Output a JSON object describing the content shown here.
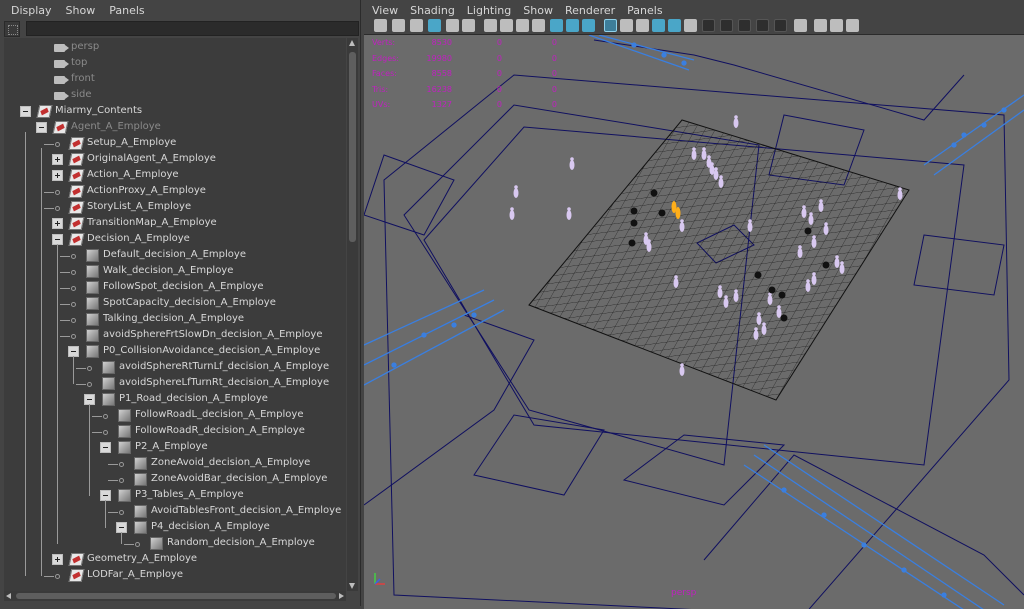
{
  "outliner": {
    "menu": [
      "Display",
      "Show",
      "Panels"
    ],
    "search_placeholder": "",
    "items": [
      {
        "label": "persp",
        "icon": "camera-icon",
        "depth": 1,
        "dim": true
      },
      {
        "label": "top",
        "icon": "camera-icon",
        "depth": 1,
        "dim": true
      },
      {
        "label": "front",
        "icon": "camera-icon",
        "depth": 1,
        "dim": true
      },
      {
        "label": "side",
        "icon": "camera-icon",
        "depth": 1,
        "dim": true
      },
      {
        "label": "Miarmy_Contents",
        "icon": "miarmy-folder-icon",
        "depth": 0,
        "expander": "minus"
      },
      {
        "label": "Agent_A_Employe",
        "icon": "miarmy-folder-icon",
        "depth": 1,
        "expander": "minus",
        "dim": true
      },
      {
        "label": "Setup_A_Employe",
        "icon": "miarmy-folder-icon",
        "depth": 2
      },
      {
        "label": "OriginalAgent_A_Employe",
        "icon": "miarmy-folder-icon",
        "depth": 2,
        "expander": "plus"
      },
      {
        "label": "Action_A_Employe",
        "icon": "miarmy-folder-icon",
        "depth": 2,
        "expander": "plus"
      },
      {
        "label": "ActionProxy_A_Employe",
        "icon": "miarmy-folder-icon",
        "depth": 2
      },
      {
        "label": "StoryList_A_Employe",
        "icon": "miarmy-folder-icon",
        "depth": 2
      },
      {
        "label": "TransitionMap_A_Employe",
        "icon": "miarmy-folder-icon",
        "depth": 2,
        "expander": "plus"
      },
      {
        "label": "Decision_A_Employe",
        "icon": "miarmy-folder-icon",
        "depth": 2,
        "expander": "minus"
      },
      {
        "label": "Default_decision_A_Employe",
        "icon": "decision-node-icon",
        "depth": 3
      },
      {
        "label": "Walk_decision_A_Employe",
        "icon": "decision-node-icon",
        "depth": 3
      },
      {
        "label": "FollowSpot_decision_A_Employe",
        "icon": "decision-node-icon",
        "depth": 3
      },
      {
        "label": "SpotCapacity_decision_A_Employe",
        "icon": "decision-node-icon",
        "depth": 3
      },
      {
        "label": "Talking_decision_A_Employe",
        "icon": "decision-node-icon",
        "depth": 3
      },
      {
        "label": "avoidSphereFrtSlowDn_decision_A_Employe",
        "icon": "decision-node-icon",
        "depth": 3
      },
      {
        "label": "P0_CollisionAvoidance_decision_A_Employe",
        "icon": "decision-node-icon",
        "depth": 3,
        "expander": "minus"
      },
      {
        "label": "avoidSphereRtTurnLf_decision_A_Employe",
        "icon": "decision-node-icon",
        "depth": 4
      },
      {
        "label": "avoidSphereLfTurnRt_decision_A_Employe",
        "icon": "decision-node-icon",
        "depth": 4
      },
      {
        "label": "P1_Road_decision_A_Employe",
        "icon": "decision-node-icon",
        "depth": 4,
        "expander": "minus"
      },
      {
        "label": "FollowRoadL_decision_A_Employe",
        "icon": "decision-node-icon",
        "depth": 5
      },
      {
        "label": "FollowRoadR_decision_A_Employe",
        "icon": "decision-node-icon",
        "depth": 5
      },
      {
        "label": "P2_A_Employe",
        "icon": "decision-node-icon",
        "depth": 5,
        "expander": "minus"
      },
      {
        "label": "ZoneAvoid_decision_A_Employe",
        "icon": "decision-node-icon",
        "depth": 6
      },
      {
        "label": "ZoneAvoidBar_decision_A_Employe",
        "icon": "decision-node-icon",
        "depth": 6
      },
      {
        "label": "P3_Tables_A_Employe",
        "icon": "decision-node-icon",
        "depth": 5,
        "expander": "minus"
      },
      {
        "label": "AvoidTablesFront_decision_A_Employe",
        "icon": "decision-node-icon",
        "depth": 6
      },
      {
        "label": "P4_decision_A_Employe",
        "icon": "decision-node-icon",
        "depth": 6,
        "expander": "minus"
      },
      {
        "label": "Random_decision_A_Employe",
        "icon": "decision-node-icon",
        "depth": 7
      },
      {
        "label": "Geometry_A_Employe",
        "icon": "miarmy-folder-icon",
        "depth": 2,
        "expander": "plus"
      },
      {
        "label": "LODFar_A_Employe",
        "icon": "miarmy-folder-icon",
        "depth": 2
      }
    ]
  },
  "viewport": {
    "menu": [
      "View",
      "Shading",
      "Lighting",
      "Show",
      "Renderer",
      "Panels"
    ],
    "hud": [
      {
        "label": "Verts:",
        "v1": "8530",
        "v2": "0",
        "v3": "0"
      },
      {
        "label": "Edges:",
        "v1": "19980",
        "v2": "0",
        "v3": "0"
      },
      {
        "label": "Faces:",
        "v1": "8558",
        "v2": "0",
        "v3": "0"
      },
      {
        "label": "Tris:",
        "v1": "16238",
        "v2": "0",
        "v3": "0"
      },
      {
        "label": "UVs:",
        "v1": "1327",
        "v2": "0",
        "v3": "0"
      }
    ],
    "camera_label": "persp",
    "colors": {
      "hud": "#c021c0",
      "wire": "#101060",
      "selected_wire": "#3a7fe0",
      "agent": "#d8c8f0",
      "agent_highlight": "#ffae1a"
    }
  }
}
